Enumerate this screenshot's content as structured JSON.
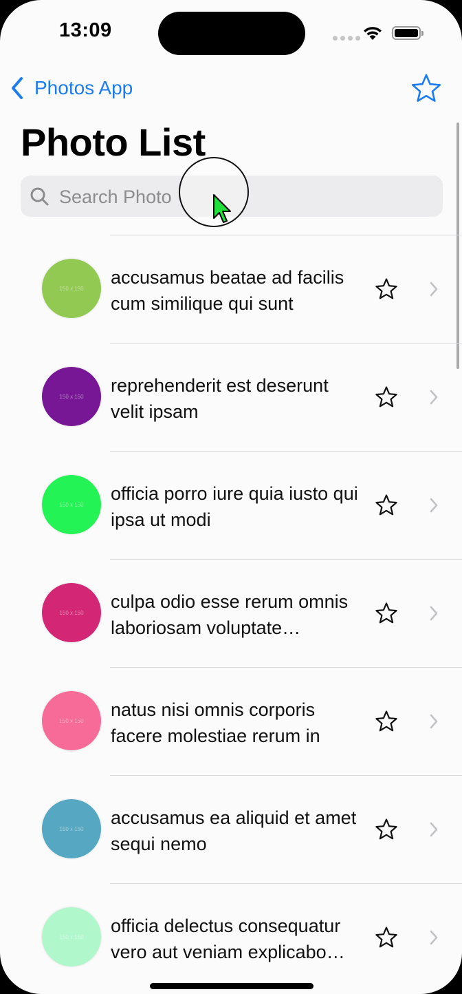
{
  "status_bar": {
    "time": "13:09"
  },
  "nav": {
    "back_label": "Photos App"
  },
  "header": {
    "title": "Photo List"
  },
  "search": {
    "placeholder": "Search Photo"
  },
  "list": {
    "items": [
      {
        "title": "accusamus beatae ad facilis cum similique qui sunt",
        "thumb_color": "#92c952",
        "thumb_text": "150 x 150"
      },
      {
        "title": "reprehenderit est deserunt velit ipsam",
        "thumb_color": "#771796",
        "thumb_text": "150 x 150"
      },
      {
        "title": "officia porro iure quia iusto qui ipsa ut modi",
        "thumb_color": "#24f355",
        "thumb_text": "150 x 150"
      },
      {
        "title": "culpa odio esse rerum omnis laboriosam voluptate repudiandae",
        "thumb_color": "#d32776",
        "thumb_text": "150 x 150"
      },
      {
        "title": "natus nisi omnis corporis facere molestiae rerum in",
        "thumb_color": "#f66b97",
        "thumb_text": "150 x 150"
      },
      {
        "title": "accusamus ea aliquid et amet sequi nemo",
        "thumb_color": "#56a8c2",
        "thumb_text": "150 x 150"
      },
      {
        "title": "officia delectus consequatur vero aut veniam explicabo molestias",
        "thumb_color": "#b0f7cc",
        "thumb_text": "150 x 150"
      }
    ]
  },
  "colors": {
    "accent": "#1a7cf0",
    "cursor": "#22e03a"
  }
}
